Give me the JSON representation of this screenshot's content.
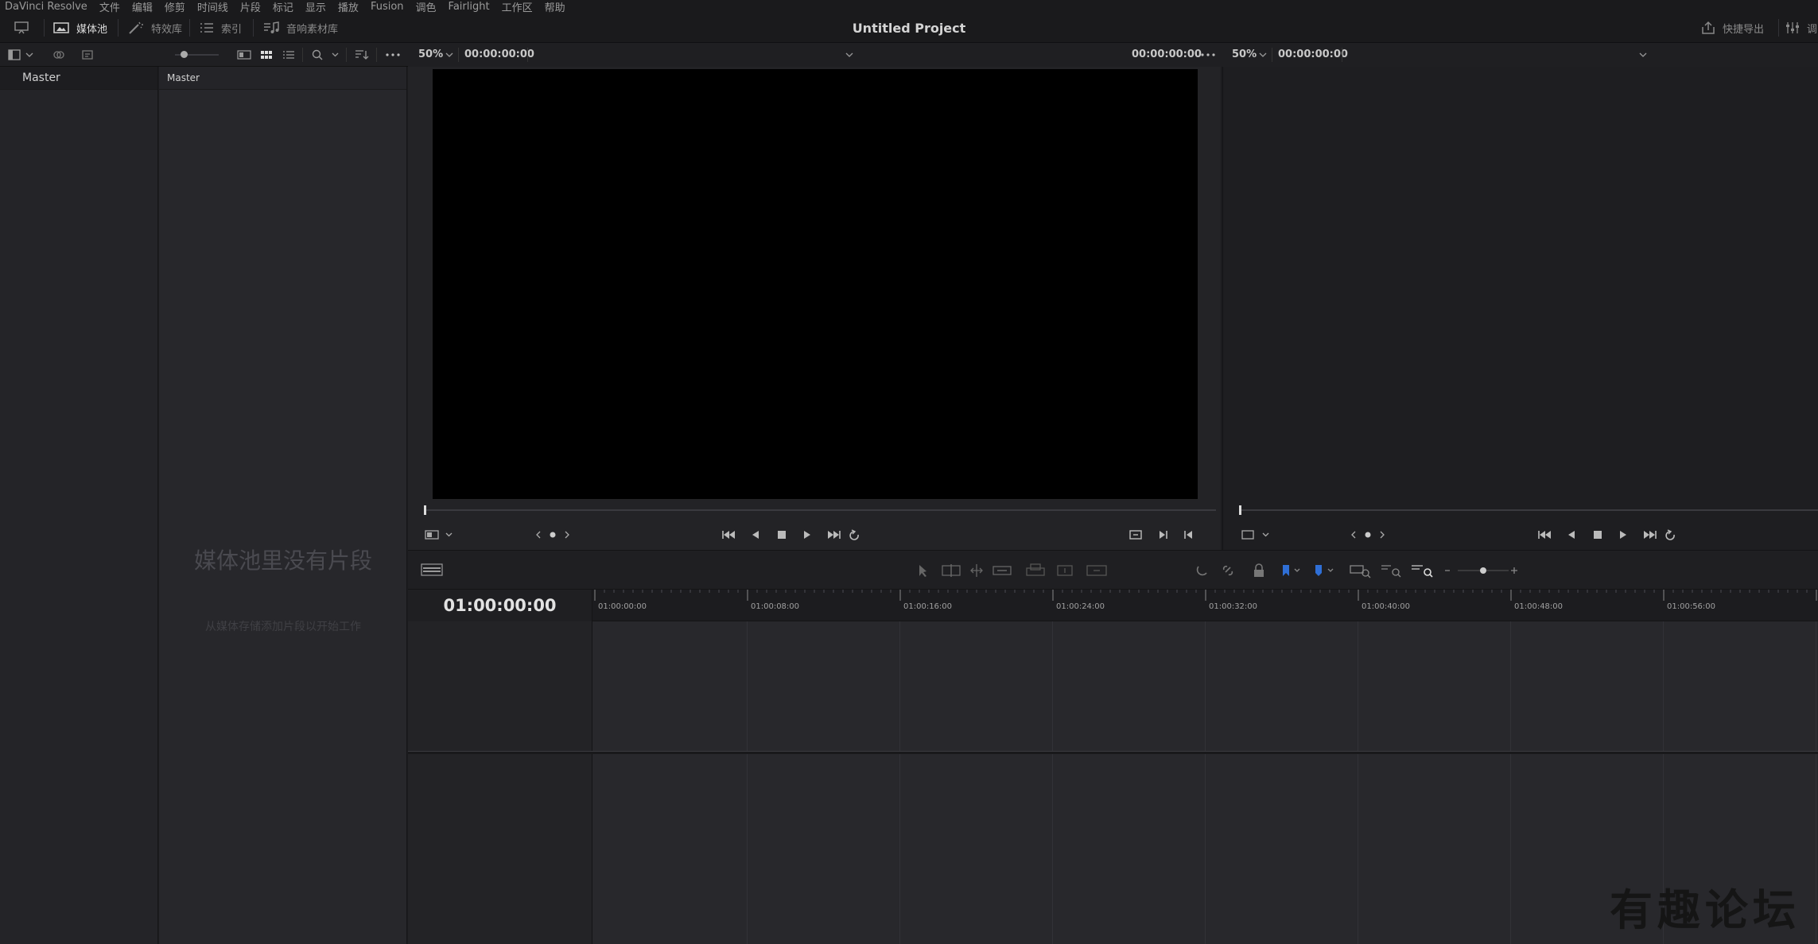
{
  "menu": [
    "DaVinci Resolve",
    "文件",
    "编辑",
    "修剪",
    "时间线",
    "片段",
    "标记",
    "显示",
    "播放",
    "Fusion",
    "调色",
    "Fairlight",
    "工作区",
    "帮助"
  ],
  "topbar": {
    "project_title": "Untitled Project",
    "media_pool_label": "媒体池",
    "effects_label": "特效库",
    "index_label": "索引",
    "sound_library_label": "音响素材库",
    "quick_export_label": "快捷导出",
    "mixer_label": "调"
  },
  "source_viewer": {
    "zoom": "50%",
    "timecode_left": "00:00:00:00",
    "timecode_right": "00:00:00:00"
  },
  "record_viewer": {
    "zoom": "50%",
    "timecode": "00:00:00:00"
  },
  "bins": {
    "header": "Master",
    "items": [
      "Master"
    ]
  },
  "media_pool": {
    "header": "Master",
    "empty_title": "媒体池里没有片段",
    "empty_subtitle": "从媒体存储添加片段以开始工作"
  },
  "timeline": {
    "timecode": "01:00:00:00",
    "ruler_labels": [
      "01:00:00:00",
      "01:00:08:00",
      "01:00:16:00",
      "01:00:24:00",
      "01:00:32:00",
      "01:00:40:00",
      "01:00:48:00",
      "01:00:56:00"
    ]
  },
  "watermark": "有趣论坛",
  "colors": {
    "accent_blue": "#2f6fd6",
    "bg": "#1c1c1f"
  }
}
